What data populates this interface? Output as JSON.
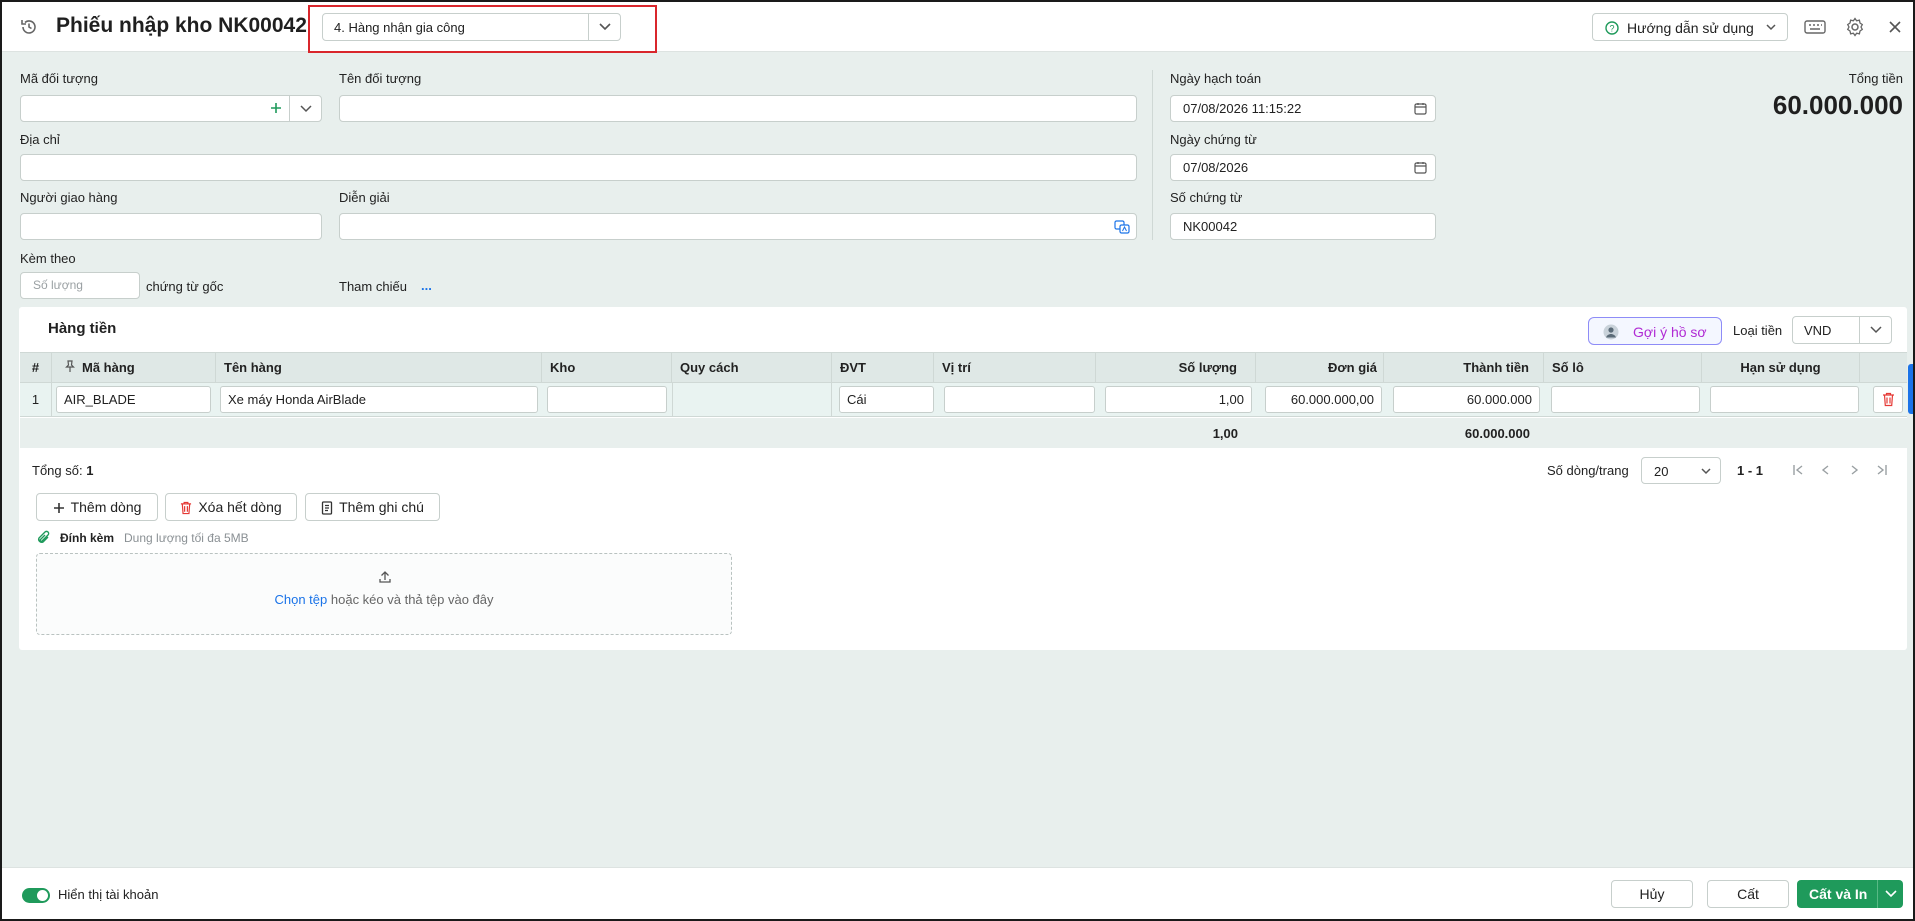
{
  "header": {
    "title": "Phiếu nhập kho NK00042",
    "type_select": "4. Hàng nhận gia công",
    "help_label": "Hướng dẫn sử dụng"
  },
  "form": {
    "ma_doi_tuong_label": "Mã đối tượng",
    "ten_doi_tuong_label": "Tên đối tượng",
    "dia_chi_label": "Địa chỉ",
    "nguoi_giao_hang_label": "Người giao hàng",
    "dien_giai_label": "Diễn giải",
    "kem_theo_label": "Kèm theo",
    "so_luong_placeholder": "Số lượng",
    "chung_tu_goc": "chứng từ gốc",
    "tham_chieu_label": "Tham chiếu",
    "tham_chieu_value": "...",
    "ngay_hach_toan_label": "Ngày hạch toán",
    "ngay_hach_toan": "07/08/2026 11:15:22",
    "ngay_chung_tu_label": "Ngày chứng từ",
    "ngay_chung_tu": "07/08/2026",
    "so_chung_tu_label": "Số chứng từ",
    "so_chung_tu": "NK00042",
    "tong_tien_label": "Tổng tiền",
    "tong_tien": "60.000.000"
  },
  "grid": {
    "tab_label": "Hàng tiền",
    "goi_y_label": "Gợi ý hồ sơ",
    "loai_tien_label": "Loại tiền",
    "loai_tien": "VND",
    "columns": [
      "#",
      "Mã hàng",
      "Tên hàng",
      "Kho",
      "Quy cách",
      "ĐVT",
      "Vị trí",
      "Số lượng",
      "Đơn giá",
      "Thành tiền",
      "Số lô",
      "Hạn sử dụng"
    ],
    "rows": [
      {
        "index": "1",
        "ma_hang": "AIR_BLADE",
        "ten_hang": "Xe máy Honda AirBlade",
        "kho": "",
        "quy_cach": "",
        "dvt": "Cái",
        "vi_tri": "",
        "so_luong": "1,00",
        "don_gia": "60.000.000,00",
        "thanh_tien": "60.000.000",
        "so_lo": "",
        "han_su_dung": ""
      }
    ],
    "total_so_luong": "1,00",
    "total_thanh_tien": "60.000.000",
    "tong_so_label": "Tổng số:",
    "tong_so": "1",
    "rows_per_page_label": "Số dòng/trang",
    "rows_per_page": "20",
    "page_range": "1 - 1"
  },
  "actions": {
    "them_dong": "Thêm dòng",
    "xoa_het_dong": "Xóa hết dòng",
    "them_ghi_chu": "Thêm ghi chú"
  },
  "attach": {
    "label": "Đính kèm",
    "limit": "Dung lượng tối đa 5MB",
    "choose": "Chọn tệp",
    "drop_text": "hoặc kéo và thả tệp vào đây"
  },
  "footer": {
    "toggle_label": "Hiển thị tài khoản",
    "cancel": "Hủy",
    "save": "Cất",
    "save_print": "Cất và In"
  },
  "colors": {
    "accent_green": "#1f9a5b",
    "link_blue": "#1a73e8",
    "red_highlight": "#d9262c",
    "delete_red": "#e53935"
  }
}
